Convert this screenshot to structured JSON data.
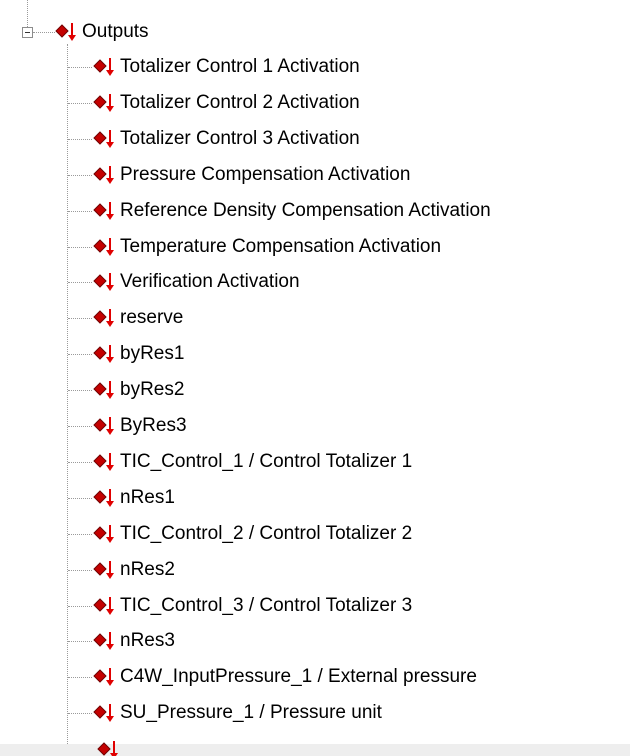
{
  "tree": {
    "root": {
      "label": "Outputs",
      "icon": "output-signal-icon",
      "expanded": true
    },
    "children": [
      {
        "label": "Totalizer Control 1 Activation",
        "icon": "output-signal-icon"
      },
      {
        "label": "Totalizer Control 2 Activation",
        "icon": "output-signal-icon"
      },
      {
        "label": "Totalizer Control 3 Activation",
        "icon": "output-signal-icon"
      },
      {
        "label": "Pressure Compensation Activation",
        "icon": "output-signal-icon"
      },
      {
        "label": "Reference Density Compensation Activation",
        "icon": "output-signal-icon"
      },
      {
        "label": "Temperature Compensation Activation",
        "icon": "output-signal-icon"
      },
      {
        "label": "Verification Activation",
        "icon": "output-signal-icon"
      },
      {
        "label": "reserve",
        "icon": "output-signal-icon"
      },
      {
        "label": "byRes1",
        "icon": "output-signal-icon"
      },
      {
        "label": "byRes2",
        "icon": "output-signal-icon"
      },
      {
        "label": "ByRes3",
        "icon": "output-signal-icon"
      },
      {
        "label": "TIC_Control_1 / Control Totalizer 1",
        "icon": "output-signal-icon"
      },
      {
        "label": "nRes1",
        "icon": "output-signal-icon"
      },
      {
        "label": "TIC_Control_2 / Control Totalizer 2",
        "icon": "output-signal-icon"
      },
      {
        "label": "nRes2",
        "icon": "output-signal-icon"
      },
      {
        "label": "TIC_Control_3 / Control Totalizer 3",
        "icon": "output-signal-icon"
      },
      {
        "label": "nRes3",
        "icon": "output-signal-icon"
      },
      {
        "label": "C4W_InputPressure_1 / External pressure",
        "icon": "output-signal-icon"
      },
      {
        "label": "SU_Pressure_1 / Pressure unit",
        "icon": "output-signal-icon"
      }
    ]
  },
  "colors": {
    "diamond": "#c40000",
    "arrow": "#e00000",
    "tree_lines": "#9a9a9a"
  }
}
